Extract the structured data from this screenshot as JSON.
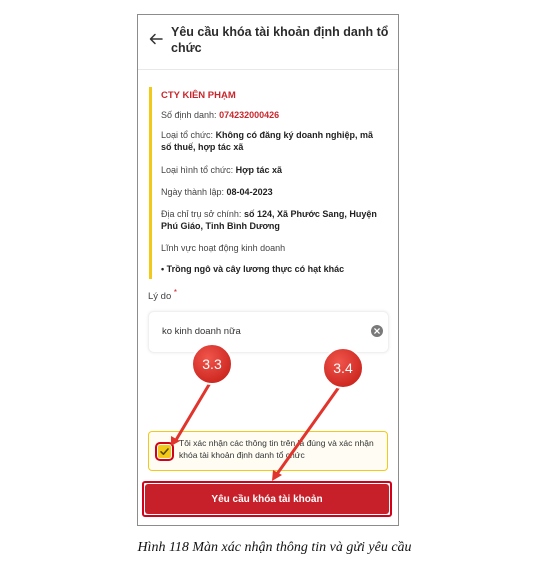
{
  "header": {
    "title": "Yêu cầu khóa tài khoản định danh tổ chức"
  },
  "org": {
    "name": "CTY KIÊN PHẠM",
    "id_label": "Số định danh: ",
    "id_value": "074232000426",
    "type_label": "Loại tổ chức: ",
    "type_value": "Không có đăng ký doanh nghiệp, mã số thuế, hợp tác xã",
    "form_label": "Loại hình tổ chức: ",
    "form_value": "Hợp tác xã",
    "founded_label": "Ngày thành lập: ",
    "founded_value": "08-04-2023",
    "address_label": "Địa chỉ trụ sở chính: ",
    "address_value": "số 124, Xã Phước Sang, Huyện Phú Giáo, Tỉnh Bình Dương",
    "field_label": "Lĩnh vực hoạt động kinh doanh",
    "field_item": "• Trồng ngô và cây lương thực có hạt khác"
  },
  "reason": {
    "label": "Lý do",
    "required_mark": "*",
    "value": "ko kinh doanh nữa"
  },
  "confirm": {
    "text": "Tôi xác nhận các thông tin trên là đúng và xác nhận khóa tài khoản định danh tổ chức",
    "checked": true
  },
  "submit": {
    "label": "Yêu cầu khóa tài khoản"
  },
  "callouts": [
    {
      "label": "3.3"
    },
    {
      "label": "3.4"
    }
  ],
  "caption": "Hình 118 Màn xác nhận thông tin và gửi yêu cầu",
  "colors": {
    "accent_red": "#c8202a",
    "highlight_yellow": "#f3c919",
    "callout_red": "#e0342c"
  }
}
